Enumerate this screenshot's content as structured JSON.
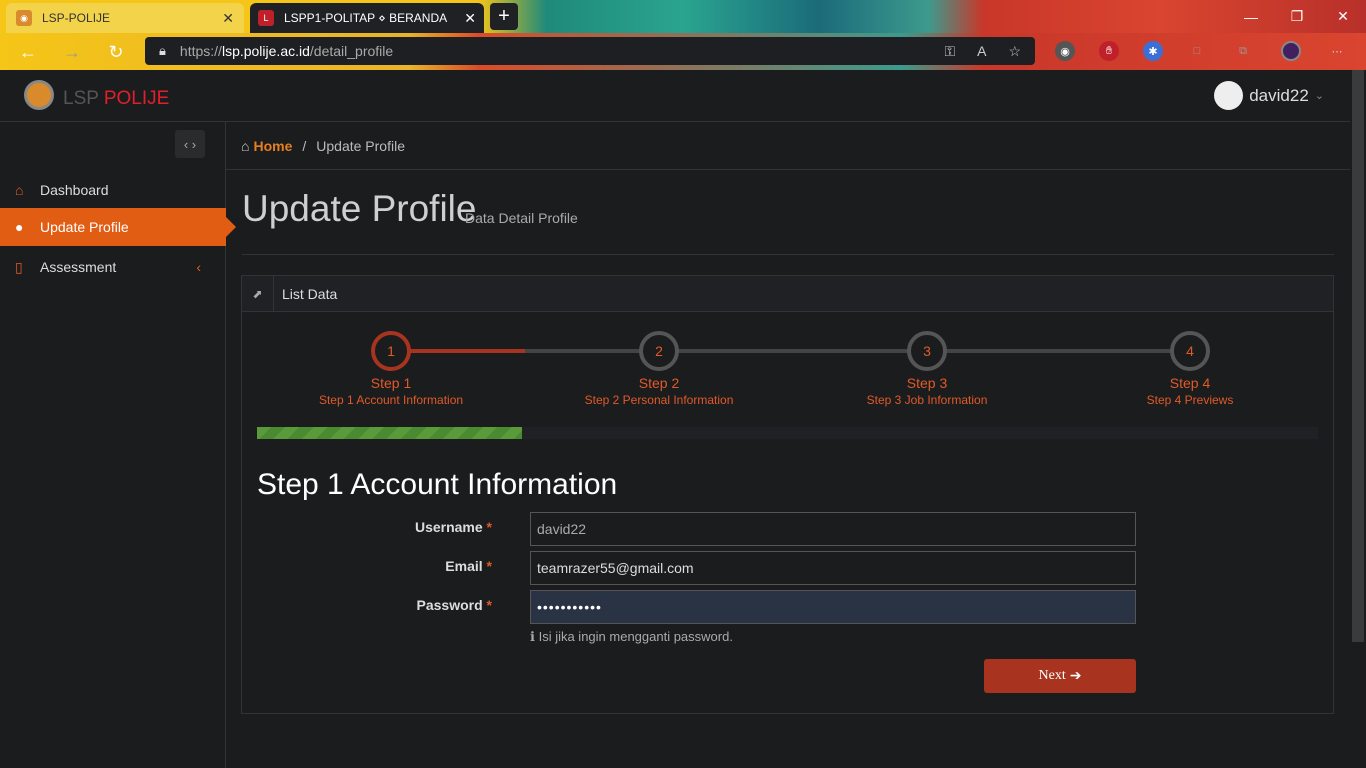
{
  "browser": {
    "tabs": [
      {
        "label": "LSP-POLIJE"
      },
      {
        "label": "LSPP1-POLITAP ⋄ BERANDA"
      }
    ],
    "new_tab": "+",
    "url_scheme": "https://",
    "url_host": "lsp.polije.ac.id",
    "url_path": "/detail_profile",
    "window": {
      "minimize": "—",
      "restore": "❐",
      "close": "✕"
    }
  },
  "app": {
    "brand_lsp": "LSP",
    "brand_name": "POLIJE",
    "user_name": "david22"
  },
  "sidebar": {
    "items": [
      {
        "label": "Dashboard",
        "icon": "home-icon"
      },
      {
        "label": "Update Profile",
        "icon": "user-icon"
      },
      {
        "label": "Assessment",
        "icon": "file-icon"
      }
    ]
  },
  "breadcrumb": {
    "home": "Home",
    "separator": "/",
    "current": "Update Profile"
  },
  "page": {
    "title": "Update Profile",
    "subtitle": "Data Detail Profile"
  },
  "panel": {
    "title": "List Data"
  },
  "wizard": {
    "steps": [
      {
        "num": "1",
        "label": "Step 1",
        "desc": "Step 1 Account Information"
      },
      {
        "num": "2",
        "label": "Step 2",
        "desc": "Step 2 Personal Information"
      },
      {
        "num": "3",
        "label": "Step 3",
        "desc": "Step 3 Job Information"
      },
      {
        "num": "4",
        "label": "Step 4",
        "desc": "Step 4 Previews"
      }
    ],
    "progress_fraction": 0.25
  },
  "form": {
    "title": "Step 1 Account Information",
    "username_label": "Username",
    "username_value": "david22",
    "email_label": "Email",
    "email_value": "teamrazer55@gmail.com",
    "password_label": "Password",
    "password_value": "•••••••••••",
    "required_mark": "*",
    "password_hint": "Isi jika ingin mengganti password.",
    "next_label": "Next"
  },
  "colors": {
    "accent": "#e25d14",
    "step_active": "#a8341f",
    "progress": "#5b9a3a"
  }
}
